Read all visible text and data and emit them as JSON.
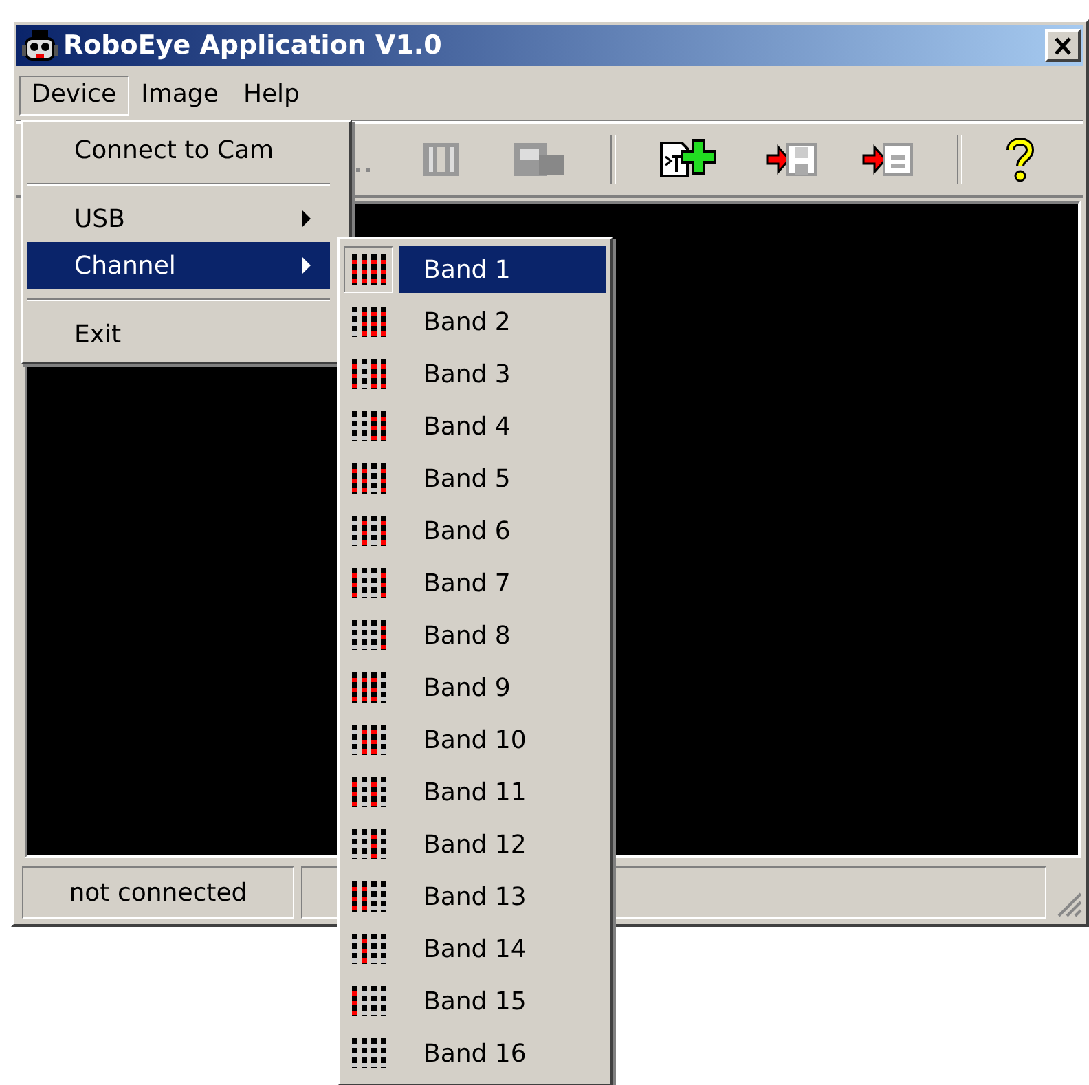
{
  "window": {
    "title": "RoboEye Application V1.0"
  },
  "menu_bar": [
    {
      "label": "Device",
      "selected": true
    },
    {
      "label": "Image",
      "selected": false
    },
    {
      "label": "Help",
      "selected": false
    }
  ],
  "device_menu": [
    {
      "kind": "item",
      "label": "Connect to Cam",
      "selected": false
    },
    {
      "kind": "separator"
    },
    {
      "kind": "submenu",
      "label": "USB",
      "selected": false
    },
    {
      "kind": "submenu",
      "label": "Channel",
      "selected": true
    },
    {
      "kind": "separator"
    },
    {
      "kind": "item",
      "label": "Exit",
      "selected": false
    }
  ],
  "channel_menu": [
    {
      "label": "Band 1",
      "selected": true,
      "bars": [
        true,
        true,
        true,
        true
      ]
    },
    {
      "label": "Band 2",
      "selected": false,
      "bars": [
        false,
        true,
        true,
        true
      ]
    },
    {
      "label": "Band 3",
      "selected": false,
      "bars": [
        true,
        false,
        true,
        true
      ]
    },
    {
      "label": "Band 4",
      "selected": false,
      "bars": [
        false,
        false,
        true,
        true
      ]
    },
    {
      "label": "Band 5",
      "selected": false,
      "bars": [
        true,
        true,
        false,
        true
      ]
    },
    {
      "label": "Band 6",
      "selected": false,
      "bars": [
        false,
        true,
        false,
        true
      ]
    },
    {
      "label": "Band 7",
      "selected": false,
      "bars": [
        true,
        false,
        false,
        true
      ]
    },
    {
      "label": "Band 8",
      "selected": false,
      "bars": [
        false,
        false,
        false,
        true
      ]
    },
    {
      "label": "Band 9",
      "selected": false,
      "bars": [
        true,
        true,
        true,
        false
      ]
    },
    {
      "label": "Band 10",
      "selected": false,
      "bars": [
        false,
        true,
        true,
        false
      ]
    },
    {
      "label": "Band 11",
      "selected": false,
      "bars": [
        true,
        false,
        true,
        false
      ]
    },
    {
      "label": "Band 12",
      "selected": false,
      "bars": [
        false,
        false,
        true,
        false
      ]
    },
    {
      "label": "Band 13",
      "selected": false,
      "bars": [
        true,
        true,
        false,
        false
      ]
    },
    {
      "label": "Band 14",
      "selected": false,
      "bars": [
        false,
        true,
        false,
        false
      ]
    },
    {
      "label": "Band 15",
      "selected": false,
      "bars": [
        true,
        false,
        false,
        false
      ]
    },
    {
      "label": "Band 16",
      "selected": false,
      "bars": [
        false,
        false,
        false,
        false
      ]
    }
  ],
  "status_bar": [
    "not connected"
  ]
}
